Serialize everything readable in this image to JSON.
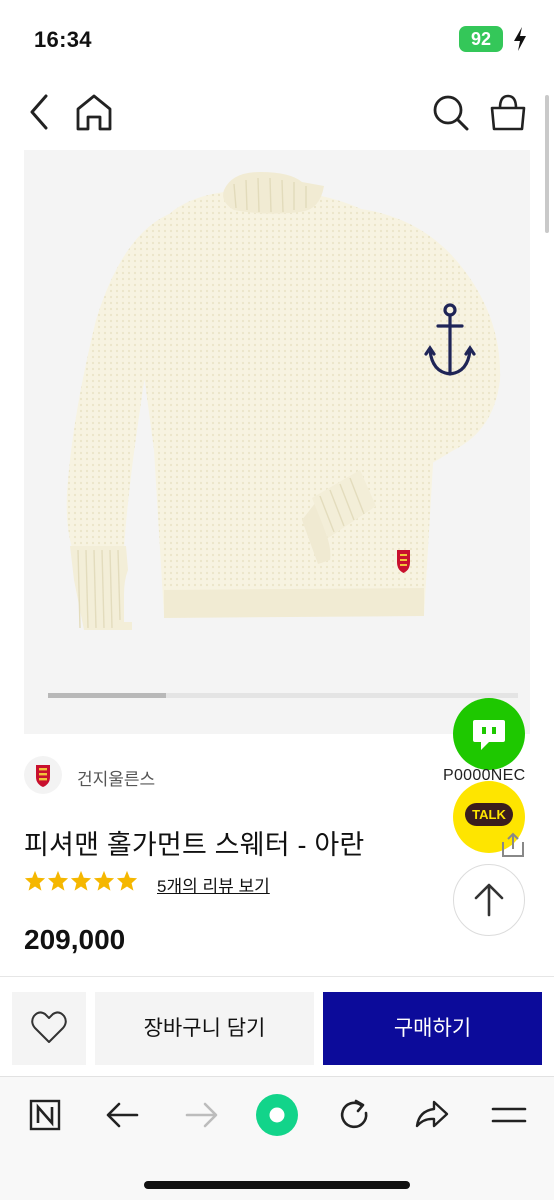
{
  "status_bar": {
    "time": "16:34",
    "battery": "92"
  },
  "header": {
    "icons": [
      "back-icon",
      "home-icon",
      "search-icon",
      "shopping-bag-icon"
    ]
  },
  "gallery": {
    "image": "cream knit sweater with anchor on sleeve",
    "position": 0.25
  },
  "floating": {
    "naver_label": "P0000NEC",
    "kakao_label": "TALK"
  },
  "product": {
    "brand": "건지울른스",
    "title": "피셔맨 홀가먼트 스웨터 - 아란",
    "rating": 5,
    "review_link": "5개의 리뷰 보기",
    "price": "209,000"
  },
  "purchase_bar": {
    "cart_label": "장바구니 담기",
    "buy_label": "구매하기"
  },
  "browser_toolbar": {
    "icons": [
      "naver-n-icon",
      "back-arrow-icon",
      "forward-arrow-icon",
      "green-dot-icon",
      "reload-icon",
      "share-icon",
      "menu-icon"
    ]
  },
  "colors": {
    "buy": "#0c0b9a",
    "star": "#f5b700",
    "naver_green": "#1ec800",
    "kakao_yellow": "#fee500",
    "battery": "#34c759"
  }
}
